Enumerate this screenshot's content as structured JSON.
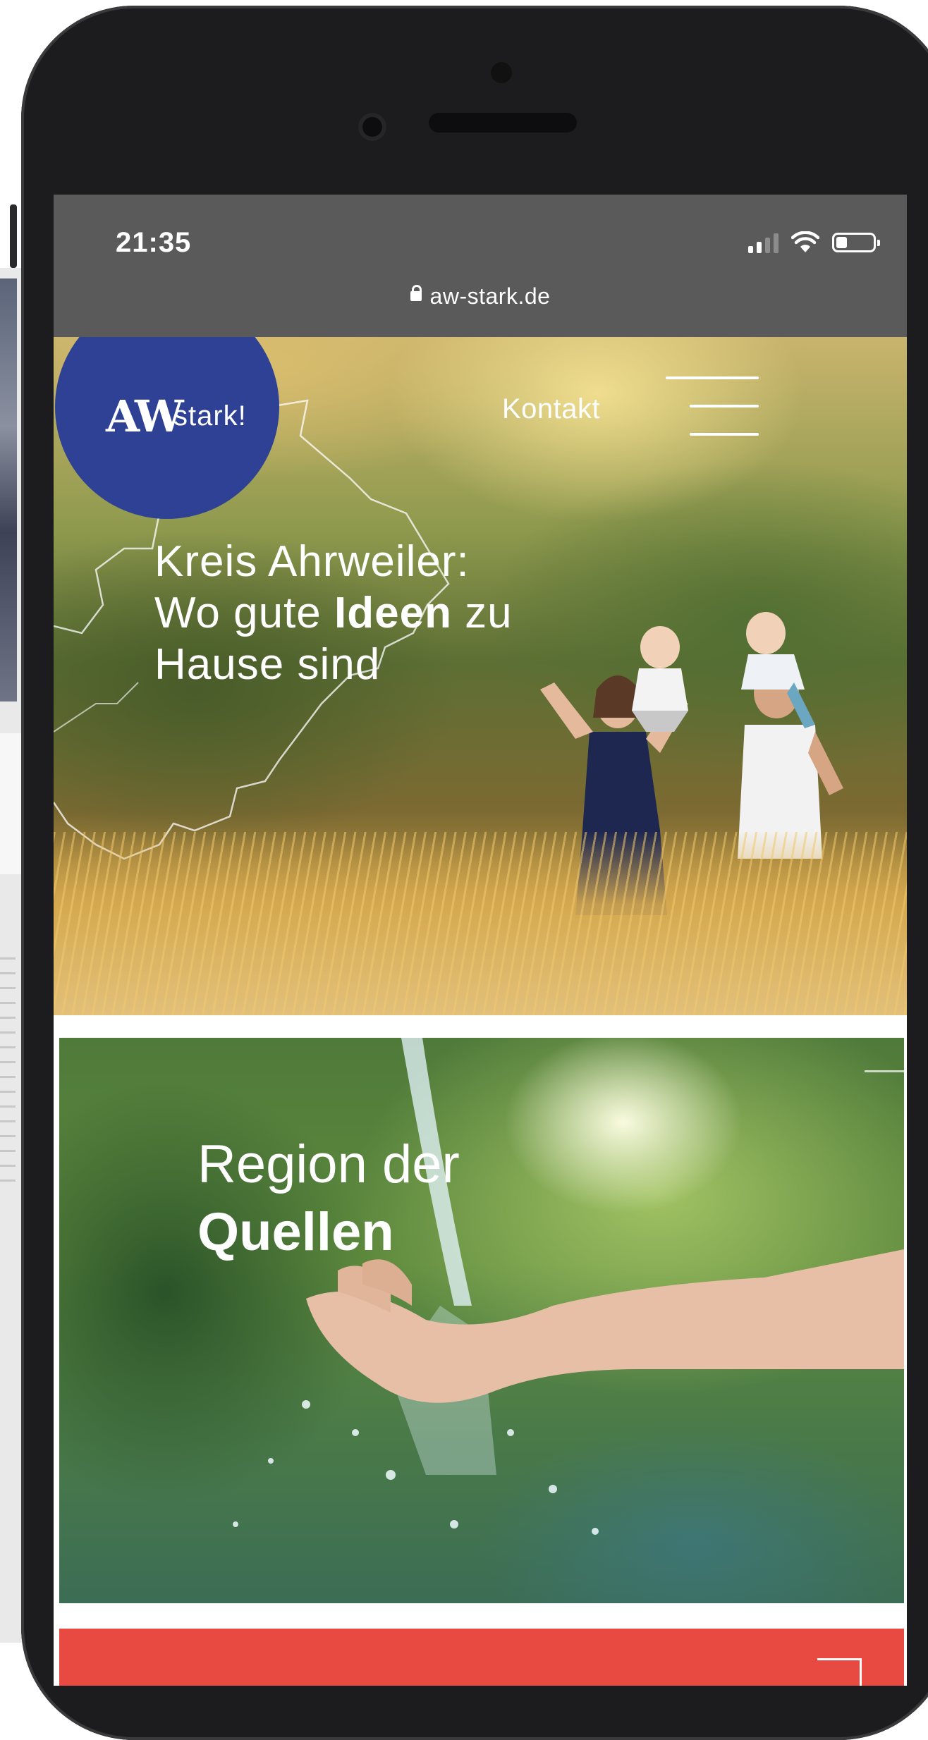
{
  "status_bar": {
    "time": "21:35",
    "url": "aw-stark.de",
    "battery_level": 0.3,
    "signal_bars_active": 2,
    "signal_bars_total": 4
  },
  "header": {
    "logo_mark": "AW",
    "logo_word": "stark!",
    "logo_color": "#2f4194",
    "nav_contact": "Kontakt",
    "menu_icon": "hamburger-icon"
  },
  "hero": {
    "title_line1": "Kreis Ahrweiler:",
    "title_line2_pre": "Wo gute ",
    "title_line2_bold": "Ideen",
    "title_line2_post": " zu",
    "title_line3": "Hause sind"
  },
  "cards": {
    "water": {
      "title_line1": "Region der",
      "title_line2": "Quellen"
    },
    "red": {
      "color": "#e84a41",
      "icon": "arrow-corner-icon"
    }
  },
  "colors": {
    "status_bar_bg": "#5a5a5a",
    "brand_blue": "#2f4194",
    "accent_red": "#e84a41"
  }
}
